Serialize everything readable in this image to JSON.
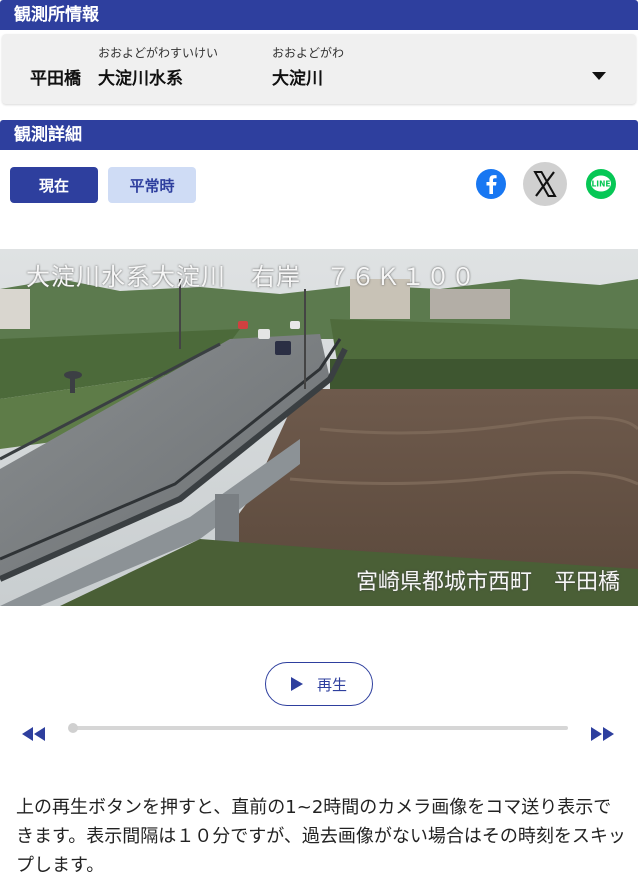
{
  "station_section": {
    "header": "観測所情報",
    "station_name": "平田橋",
    "river_system_ruby": "おおよどがわすいけい",
    "river_system": "大淀川水系",
    "river_ruby": "おおよどがわ",
    "river": "大淀川"
  },
  "detail_section": {
    "header": "観測詳細",
    "now_button": "現在",
    "normal_button": "平常時"
  },
  "share": {
    "facebook_icon": "facebook-icon",
    "x_icon": "x-icon",
    "line_icon": "line-icon",
    "line_text": "LINE",
    "colors": {
      "facebook": "#1877f2",
      "x_bg": "#d0d0d0",
      "line": "#06c755"
    }
  },
  "camera": {
    "caption_top": "大淀川水系大淀川　右岸　７６Ｋ１００",
    "caption_bottom": "宮崎県都城市西町　平田橋"
  },
  "player": {
    "play_label": "再生",
    "progress": 0
  },
  "description": "上の再生ボタンを押すと、直前の1~2時間のカメラ画像をコマ送り表示できます。表示間隔は１０分ですが、過去画像がない場合はその時刻をスキップします。",
  "colors": {
    "accent": "#2e3f9e",
    "secondary_button": "#cfdcf5"
  }
}
